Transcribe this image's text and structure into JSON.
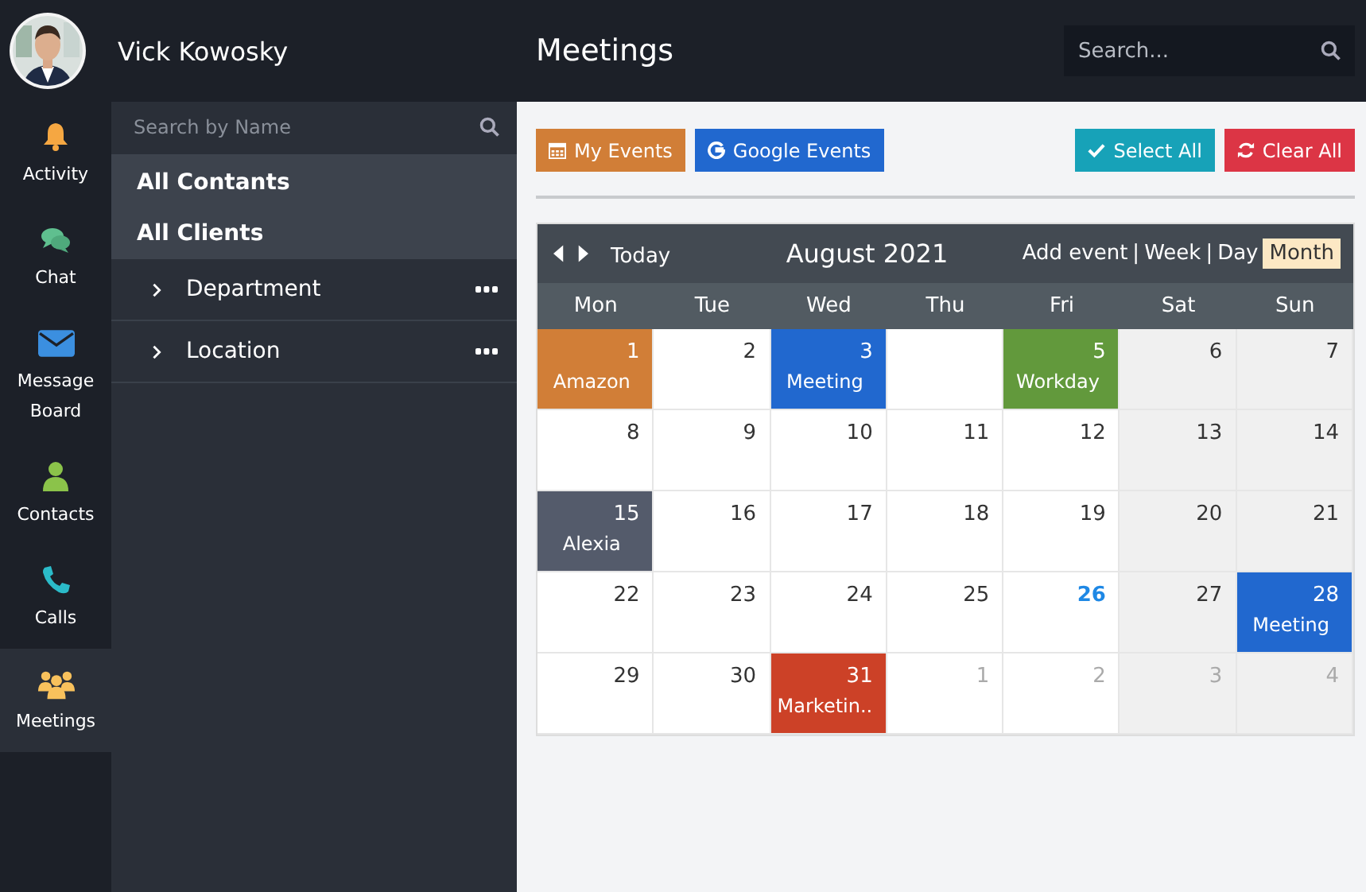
{
  "user": {
    "name": "Vick Kowosky"
  },
  "nav": [
    {
      "kind": "bell",
      "label": "Activity",
      "selected": false
    },
    {
      "kind": "chat",
      "label": "Chat",
      "selected": false
    },
    {
      "kind": "mail",
      "label": "Message Board",
      "selected": false
    },
    {
      "kind": "person",
      "label": "Contacts",
      "selected": false
    },
    {
      "kind": "phone",
      "label": "Calls",
      "selected": false
    },
    {
      "kind": "group",
      "label": "Meetings",
      "selected": true
    }
  ],
  "sidebar": {
    "search": {
      "placeholder": "Search by Name"
    },
    "filters": [
      "All Contants",
      "All Clients"
    ],
    "groups": [
      {
        "label": "Department",
        "expanded": false
      },
      {
        "label": "Location",
        "expanded": false
      }
    ]
  },
  "page": {
    "title": "Meetings",
    "search": {
      "placeholder": "Search..."
    }
  },
  "toolbar": {
    "left": [
      {
        "kind": "calendar",
        "label": "My Events",
        "color": "#d17e37"
      },
      {
        "kind": "google",
        "label": "Google Events",
        "color": "#2168cf"
      }
    ],
    "right": [
      {
        "kind": "check",
        "label": "Select All",
        "color": "#17a2b8"
      },
      {
        "kind": "refresh",
        "label": "Clear All",
        "color": "#dc3545"
      }
    ]
  },
  "calendar": {
    "title": "August 2021",
    "today_label": "Today",
    "separator": "|",
    "views": [
      {
        "label": "Add event",
        "selected": false
      },
      {
        "label": "Week",
        "selected": false
      },
      {
        "label": "Day",
        "selected": false
      },
      {
        "label": "Month",
        "selected": true
      }
    ],
    "weekdays": [
      "Mon",
      "Tue",
      "Wed",
      "Thu",
      "Fri",
      "Sat",
      "Sun"
    ],
    "weeks": [
      [
        {
          "kind": "day",
          "day": "1",
          "event": "Amazon",
          "color": "#d17e37"
        },
        {
          "kind": "day",
          "day": "2"
        },
        {
          "kind": "day",
          "day": "3",
          "event": "Meeting",
          "color": "#2168cf"
        },
        {
          "kind": "blank"
        },
        {
          "kind": "day",
          "day": "5",
          "event": "Workday",
          "color": "#62993c"
        },
        {
          "kind": "day",
          "day": "6"
        },
        {
          "kind": "day",
          "day": "7"
        }
      ],
      [
        {
          "kind": "day",
          "day": "8"
        },
        {
          "kind": "day",
          "day": "9"
        },
        {
          "kind": "day",
          "day": "10"
        },
        {
          "kind": "day",
          "day": "11"
        },
        {
          "kind": "day",
          "day": "12"
        },
        {
          "kind": "day",
          "day": "13"
        },
        {
          "kind": "day",
          "day": "14"
        }
      ],
      [
        {
          "kind": "day",
          "day": "15",
          "event": "Alexia",
          "color": "#545b6b"
        },
        {
          "kind": "day",
          "day": "16"
        },
        {
          "kind": "day",
          "day": "17"
        },
        {
          "kind": "day",
          "day": "18"
        },
        {
          "kind": "day",
          "day": "19"
        },
        {
          "kind": "day",
          "day": "20"
        },
        {
          "kind": "day",
          "day": "21"
        }
      ],
      [
        {
          "kind": "day",
          "day": "22"
        },
        {
          "kind": "day",
          "day": "23"
        },
        {
          "kind": "day",
          "day": "24"
        },
        {
          "kind": "day",
          "day": "25"
        },
        {
          "kind": "day",
          "day": "26",
          "today": true
        },
        {
          "kind": "day",
          "day": "27"
        },
        {
          "kind": "day",
          "day": "28",
          "event": "Meeting",
          "color": "#2168cf"
        }
      ],
      [
        {
          "kind": "day",
          "day": "29"
        },
        {
          "kind": "day",
          "day": "30"
        },
        {
          "kind": "day",
          "day": "31",
          "event": "Marketin..",
          "color": "#cc4127"
        },
        {
          "kind": "day",
          "day": "1",
          "other_month": true
        },
        {
          "kind": "day",
          "day": "2",
          "other_month": true
        },
        {
          "kind": "day",
          "day": "3",
          "other_month": true
        },
        {
          "kind": "day",
          "day": "4",
          "other_month": true
        }
      ]
    ]
  }
}
